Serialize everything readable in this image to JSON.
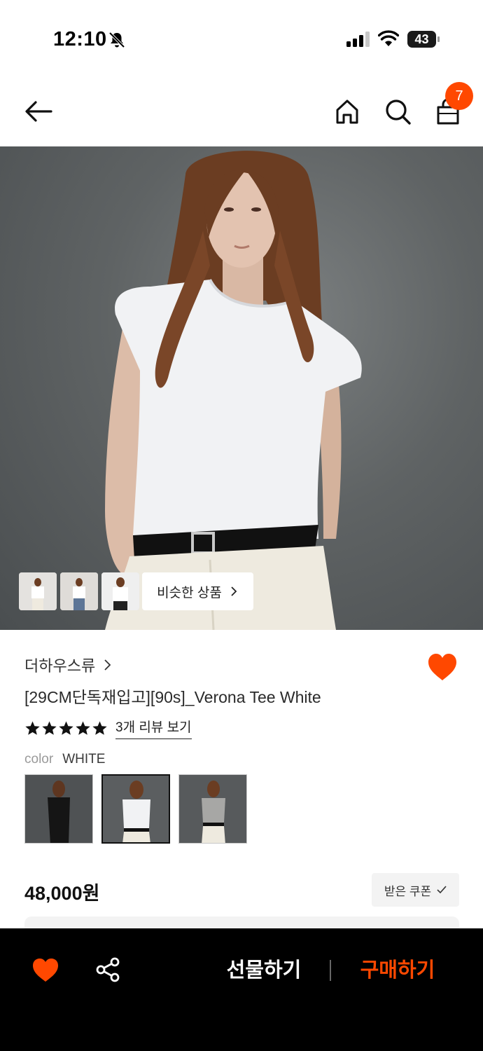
{
  "status_bar": {
    "time": "12:10",
    "battery": "43"
  },
  "nav": {
    "cart_count": "7"
  },
  "hero": {
    "similar_label": "비슷한 상품"
  },
  "product": {
    "brand": "더하우스류",
    "title": "[29CM단독재입고][90s]_Verona Tee White",
    "rating": 5,
    "review_link": "3개 리뷰 보기",
    "color_label": "color",
    "color_value": "WHITE",
    "price": "48,000원",
    "coupon_label": "받은 쿠폰"
  },
  "bottom_bar": {
    "gift_label": "선물하기",
    "buy_label": "구매하기"
  },
  "colors": {
    "accent": "#ff4800",
    "bar_bg": "#000000"
  }
}
